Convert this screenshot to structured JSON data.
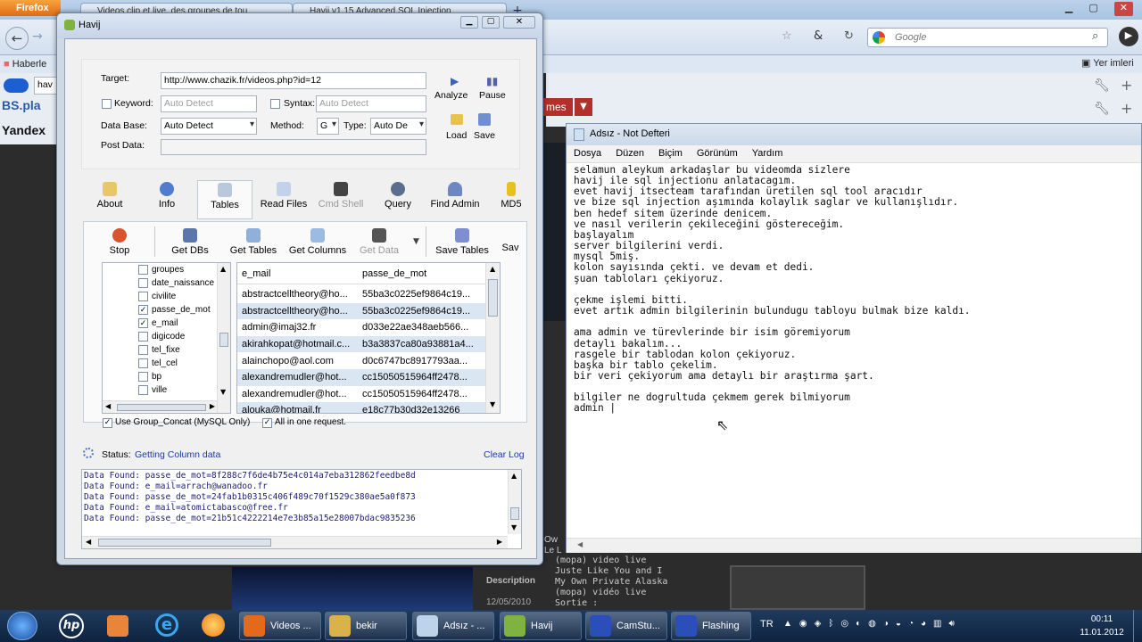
{
  "browser": {
    "name": "Firefox",
    "tabs": [
      "Videos clip et live, des groupes de tou",
      "Havij v1.15 Advanced SQL Injection"
    ],
    "search_placeholder": "Google",
    "bookmarks_left": [
      "Haberle",
      "hav",
      "BS.pla",
      "Yandex"
    ],
    "bookmark_right": "Yer imleri",
    "behind_tab_label": "mes",
    "bg_texts": {
      "description_label": "Description",
      "desc_text": "(mopa) video live Juste Like You and I My Own Private Alaska (mopa) vidéo live Sortie :",
      "date": "12/05/2010",
      "side_text": "Ow Le L"
    }
  },
  "havij": {
    "title": "Havij",
    "target_label": "Target:",
    "target_value": "http://www.chazik.fr/videos.php?id=12",
    "keyword_label": "Keyword:",
    "keyword_value": "Auto Detect",
    "syntax_label": "Syntax:",
    "syntax_value": "Auto Detect",
    "database_label": "Data Base:",
    "database_value": "Auto Detect",
    "method_label": "Method:",
    "method_value": "G",
    "type_label": "Type:",
    "type_value": "Auto De",
    "postdata_label": "Post Data:",
    "analyze_label": "Analyze",
    "pause_label": "Pause",
    "load_label": "Load",
    "save_label": "Save",
    "main_tabs": [
      "About",
      "Info",
      "Tables",
      "Read Files",
      "Cmd Shell",
      "Query",
      "Find Admin",
      "MD5"
    ],
    "sub_toolbar": [
      "Stop",
      "Get DBs",
      "Get Tables",
      "Get Columns",
      "Get Data",
      "Save Tables",
      "Sav"
    ],
    "tree_items": [
      {
        "label": "groupes",
        "checked": false
      },
      {
        "label": "date_naissance",
        "checked": false
      },
      {
        "label": "civilite",
        "checked": false
      },
      {
        "label": "passe_de_mot",
        "checked": true
      },
      {
        "label": "e_mail",
        "checked": true
      },
      {
        "label": "digicode",
        "checked": false
      },
      {
        "label": "tel_fixe",
        "checked": false
      },
      {
        "label": "tel_cel",
        "checked": false
      },
      {
        "label": "bp",
        "checked": false
      },
      {
        "label": "ville",
        "checked": false
      }
    ],
    "grid_headers": [
      "e_mail",
      "passe_de_mot"
    ],
    "grid_rows": [
      [
        "abstractcelltheory@ho...",
        "55ba3c0225ef9864c19..."
      ],
      [
        "abstractcelltheory@ho...",
        "55ba3c0225ef9864c19..."
      ],
      [
        "admin@imaj32.fr",
        "d033e22ae348aeb566..."
      ],
      [
        "akirahkopat@hotmail.c...",
        "b3a3837ca80a93881a4..."
      ],
      [
        "alainchopo@aol.com",
        "d0c6747bc8917793aa..."
      ],
      [
        "alexandremudler@hot...",
        "cc15050515964ff2478..."
      ],
      [
        "alexandremudler@hot...",
        "cc15050515964ff2478..."
      ],
      [
        "alouka@hotmail.fr",
        "e18c77b30d32e13266"
      ]
    ],
    "group_concat_label": "Use Group_Concat (MySQL Only)",
    "one_request_label": "All in one request.",
    "status_label": "Status:",
    "status_value": "Getting Column data",
    "clear_log": "Clear Log",
    "log_lines": [
      "Data Found: passe_de_mot=8f288c7f6de4b75e4c014a7eba312862feedbe8d",
      "Data Found: e_mail=arrach@wanadoo.fr",
      "Data Found: passe_de_mot=24fab1b0315c406f489c70f1529c380ae5a0f873",
      "Data Found: e_mail=atomictabasco@free.fr",
      "Data Found: passe_de_mot=21b51c4222214e7e3b85a15e28007bdac9835236"
    ]
  },
  "notepad": {
    "title": "Adsız - Not Defteri",
    "menu": [
      "Dosya",
      "Düzen",
      "Biçim",
      "Görünüm",
      "Yardım"
    ],
    "text": "selamun aleykum arkadaşlar bu videomda sizlere\nhavij ile sql injectionu anlatacagım.\nevet havij itsecteam tarafından üretilen sql tool aracıdır\nve bize sql injection aşımında kolaylık saglar ve kullanışlıdır.\nben hedef sitem üzerinde denicem.\nve nasıl verilerin çekileceğini göstereceğim.\nbaşlayalım\nserver bilgilerini verdi.\nmysql 5miş.\nkolon sayısında çekti. ve devam et dedi.\nşuan tabloları çekiyoruz.\n\nçekme işlemi bitti.\nevet artık admin bilgilerinin bulundugu tabloyu bulmak bize kaldı.\n\nama admin ve türevlerinde bir isim göremiyorum\ndetaylı bakalım...\nrasgele bir tablodan kolon çekiyoruz.\nbaşka bir tablo çekelim.\nbir veri çekiyorum ama detaylı bir araştırma şart.\n\nbilgiler ne dogrultuda çekmem gerek bilmiyorum\nadmin |"
  },
  "taskbar": {
    "buttons": [
      "Videos ...",
      "bekir",
      "Adsız - ...",
      "Havij",
      "CamStu...",
      "Flashing"
    ],
    "language": "TR",
    "time": "00:11",
    "date": "11.01.2012"
  },
  "colors": {
    "havij_frame": "#cfd9e6",
    "taskbar": "#1f3b5e",
    "link_blue": "#1a3d9c",
    "log_text": "#1d1d7a"
  }
}
